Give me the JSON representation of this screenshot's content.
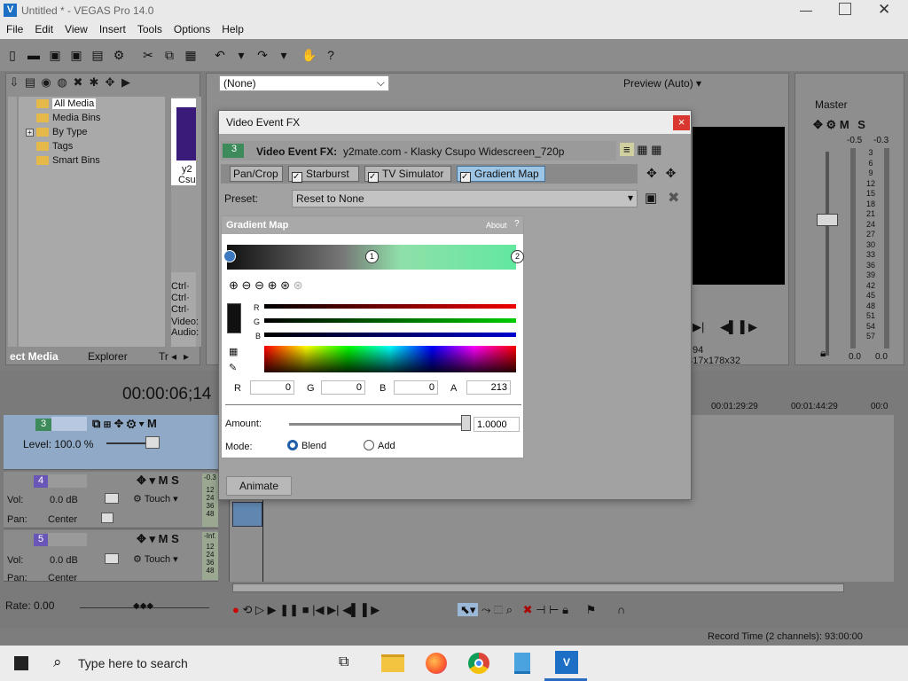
{
  "window": {
    "title": "Untitled * - VEGAS Pro 14.0"
  },
  "menu": [
    "File",
    "Edit",
    "View",
    "Insert",
    "Tools",
    "Options",
    "Help"
  ],
  "explorer": {
    "items": [
      "All Media",
      "Media Bins",
      "By Type",
      "Tags",
      "Smart Bins"
    ],
    "expand_glyph": "+",
    "tabs": [
      "ect Media",
      "Explorer",
      "Tr"
    ],
    "thumb_caption": [
      "y2",
      "Csu"
    ],
    "ctrl_labels": [
      "Ctrl·",
      "Ctrl·",
      "Ctrl·"
    ],
    "info_labels": [
      "Video:",
      "Audio:"
    ]
  },
  "preview": {
    "filter_value": "(None)",
    "mode": "Preview (Auto)",
    "frame": "94",
    "dims": "317x178x32"
  },
  "master": {
    "label": "Master",
    "left_db": "-0.5",
    "right_db": "-0.3",
    "scale": [
      "3",
      "6",
      "9",
      "12",
      "15",
      "18",
      "21",
      "24",
      "27",
      "30",
      "33",
      "36",
      "39",
      "42",
      "45",
      "48",
      "51",
      "54",
      "57"
    ],
    "bottom": [
      "0.0",
      "0.0"
    ],
    "m_label": "M",
    "s_label": "S"
  },
  "timecode": "00:00:06;14",
  "ruler": [
    "00:01:29:29",
    "00:01:44:29",
    "00:0"
  ],
  "tracks": [
    {
      "num": "3",
      "level": "Level: 100.0 %"
    },
    {
      "num": "4",
      "vol_label": "Vol:",
      "vol": "0.0 dB",
      "pan_label": "Pan:",
      "pan": "Center",
      "mode": "Touch",
      "meter_top": "-0.3",
      "meter": [
        "12",
        "24",
        "36",
        "48"
      ]
    },
    {
      "num": "5",
      "vol_label": "Vol:",
      "vol": "0.0 dB",
      "pan_label": "Pan:",
      "pan": "Center",
      "mode": "Touch",
      "meter_top": "-Inf.",
      "meter": [
        "12",
        "24",
        "36",
        "48"
      ]
    }
  ],
  "rate": "Rate: 0.00",
  "status": "Record Time (2 channels): 93:00:00",
  "dialog": {
    "title": "Video Event FX",
    "close": "×",
    "event_num": "3",
    "event_label": "Video Event FX:",
    "event_name": "y2mate.com - Klasky Csupo Widescreen_720p",
    "chain": [
      "Pan/Crop",
      "Starburst",
      "TV Simulator",
      "Gradient Map"
    ],
    "preset_label": "Preset:",
    "preset_value": "Reset to None",
    "plugin_name": "Gradient Map",
    "about": "About",
    "help": "?",
    "marker_mid": "1",
    "marker_end": "2",
    "slider_labels": [
      "R",
      "G",
      "B"
    ],
    "rgba_labels": [
      "R",
      "G",
      "B",
      "A"
    ],
    "rgba_values": [
      "0",
      "0",
      "0",
      "213"
    ],
    "amount_label": "Amount:",
    "amount_value": "1.0000",
    "amount_fraction": 1.0,
    "mode_label": "Mode:",
    "modes": [
      "Blend",
      "Add"
    ],
    "animate": "Animate"
  },
  "taskbar": {
    "search_placeholder": "Type here to search"
  }
}
